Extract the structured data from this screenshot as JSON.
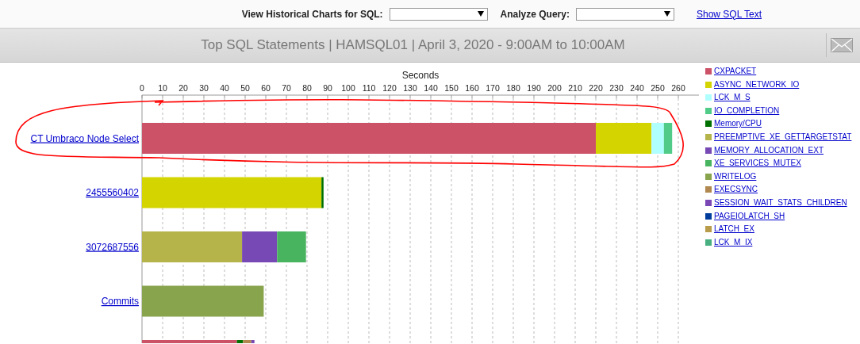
{
  "toolbar": {
    "fields": [
      {
        "label": "View Historical Charts for SQL:"
      },
      {
        "label": "Analyze Query:"
      }
    ],
    "link": "Show SQL Text"
  },
  "title_bar": {
    "title": "Top SQL Statements | HAMSQL01 | April 3, 2020 - 9:00AM to 10:00AM"
  },
  "chart": {
    "chart_data": {
      "type": "bar",
      "orientation": "horizontal",
      "stacked": true,
      "grid": true,
      "xlabel": "Seconds",
      "xlim": [
        0,
        270
      ],
      "xticks": [
        0,
        10,
        20,
        30,
        40,
        50,
        60,
        70,
        80,
        90,
        100,
        110,
        120,
        130,
        140,
        150,
        160,
        170,
        180,
        190,
        200,
        210,
        220,
        230,
        240,
        250,
        260
      ],
      "categories": [
        "CT Umbraco Node Select",
        "2455560402",
        "3072687556",
        "Commits",
        null
      ],
      "series": [
        {
          "name": "CXPACKET",
          "color": "#cc5268",
          "values": [
            220,
            0,
            0,
            0,
            46
          ]
        },
        {
          "name": "ASYNC_NETWORK_IO",
          "color": "#d4d400",
          "values": [
            27,
            87,
            0,
            0,
            0
          ]
        },
        {
          "name": "LCK_M_S",
          "color": "#b0ffff",
          "values": [
            6,
            0,
            0,
            0,
            0
          ]
        },
        {
          "name": "IO_COMPLETION",
          "color": "#50cc88",
          "values": [
            4,
            0,
            0,
            0,
            0
          ]
        },
        {
          "name": "Memory/CPU",
          "color": "#007000",
          "values": [
            0,
            1,
            0,
            0,
            3
          ]
        },
        {
          "name": "PREEMPTIVE_XE_GETTARGETSTAT",
          "color": "#b4b44a",
          "values": [
            0,
            0,
            48.5,
            0,
            0
          ]
        },
        {
          "name": "MEMORY_ALLOCATION_EXT",
          "color": "#7649b4",
          "values": [
            0,
            0,
            17,
            0,
            0
          ]
        },
        {
          "name": "XE_SERVICES_MUTEX",
          "color": "#48b460",
          "values": [
            0,
            0,
            14,
            0,
            0
          ]
        },
        {
          "name": "WRITELOG",
          "color": "#88a44c",
          "values": [
            0,
            0,
            0,
            59,
            0
          ]
        },
        {
          "name": "EXECSYNC",
          "color": "#b08850",
          "values": [
            0,
            0,
            0,
            0,
            4
          ]
        },
        {
          "name": "SESSION_WAIT_STATS_CHILDREN",
          "color": "#7a48b4",
          "values": [
            0,
            0,
            0,
            0,
            1.5
          ]
        },
        {
          "name": "PAGEIOLATCH_SH",
          "color": "#003c9c",
          "values": [
            0,
            0,
            0,
            0,
            0
          ]
        },
        {
          "name": "LATCH_EX",
          "color": "#b89c4c",
          "values": [
            0,
            0,
            0,
            0,
            0
          ]
        },
        {
          "name": "LCK_M_IX",
          "color": "#48b080",
          "values": [
            0,
            0,
            0,
            0,
            0
          ]
        }
      ]
    }
  }
}
